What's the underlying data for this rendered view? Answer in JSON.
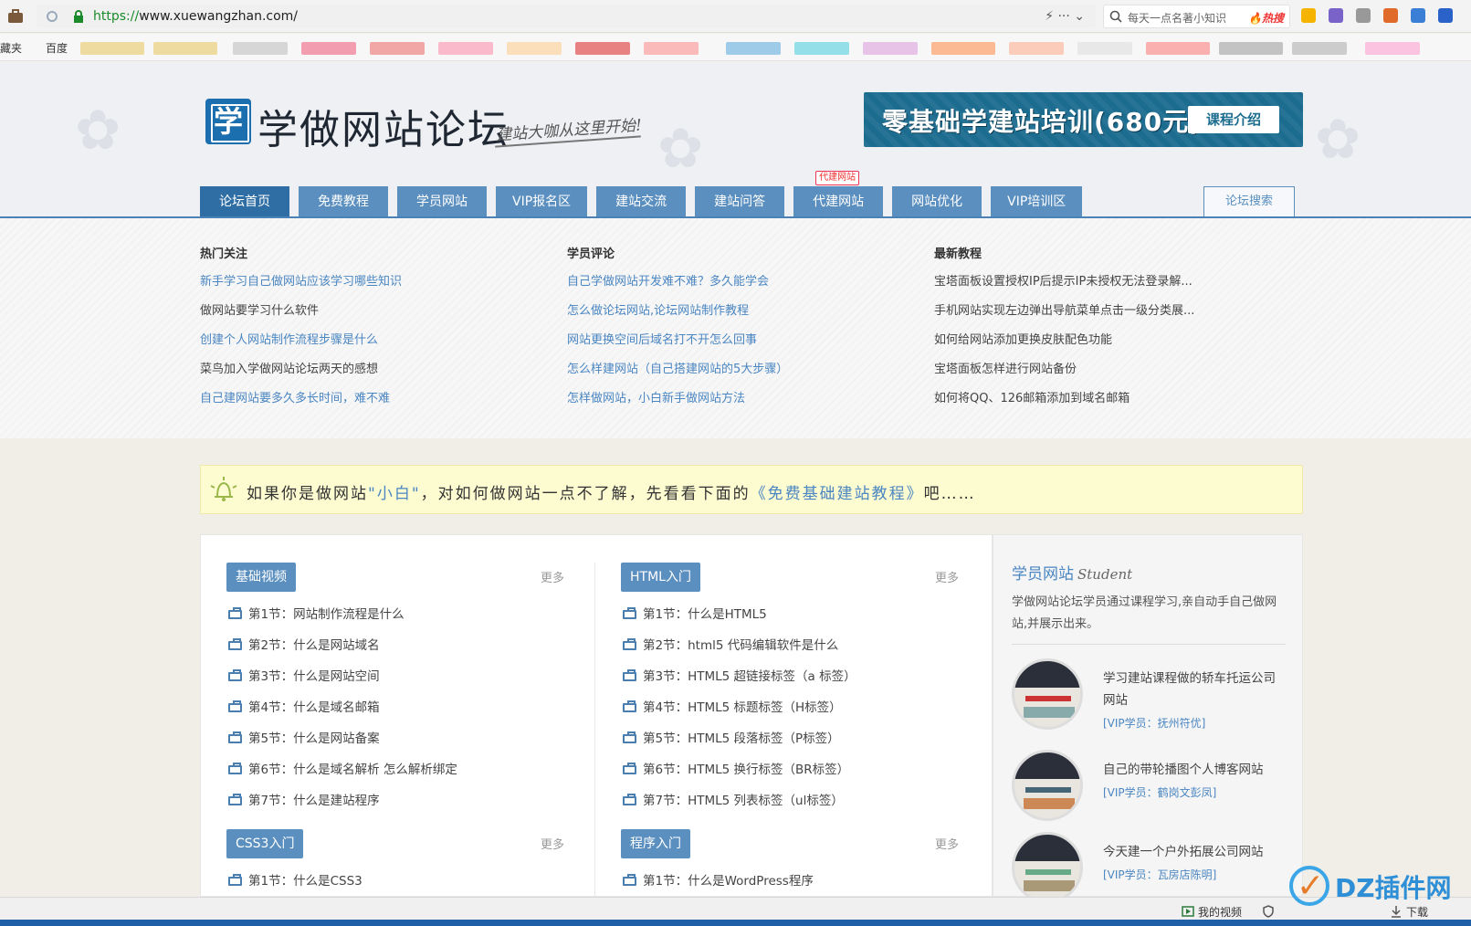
{
  "browser": {
    "url_scheme": "https://",
    "url_rest": "www.xuewangzhan.com/",
    "tools": "⚡  ···  ⌄",
    "search_hint": "每天一点名著小知识",
    "search_hot": "🔥热搜"
  },
  "bookmarks": {
    "favorites": "藏夹",
    "baidu": "百度"
  },
  "header": {
    "logo_glyph": "学",
    "site_title": "学做网站论坛",
    "slogan": "建站大咖从这里开始!",
    "banner_text": "零基础学建站培训(680元)",
    "banner_button": "课程介绍"
  },
  "nav": {
    "items": [
      {
        "label": "论坛首页"
      },
      {
        "label": "免费教程"
      },
      {
        "label": "学员网站"
      },
      {
        "label": "VIP报名区"
      },
      {
        "label": "建站交流"
      },
      {
        "label": "建站问答"
      },
      {
        "label": "代建网站",
        "badge": "代建网站"
      },
      {
        "label": "网站优化"
      },
      {
        "label": "VIP培训区"
      }
    ],
    "search_label": "论坛搜索"
  },
  "hot": {
    "columns": [
      {
        "heading": "热门关注",
        "links": [
          "新手学习自己做网站应该学习哪些知识",
          "做网站要学习什么软件",
          "创建个人网站制作流程步骤是什么",
          "菜鸟加入学做网站论坛两天的感想",
          "自己建网站要多久多长时间，难不难"
        ]
      },
      {
        "heading": "学员评论",
        "links": [
          "自己学做网站开发难不难？多久能学会",
          "怎么做论坛网站,论坛网站制作教程",
          "网站更换空间后域名打不开怎么回事",
          "怎么样建网站（自己搭建网站的5大步骤）",
          "怎样做网站，小白新手做网站方法"
        ]
      },
      {
        "heading": "最新教程",
        "links": [
          "宝塔面板设置授权IP后提示IP未授权无法登录解...",
          "手机网站实现左边弹出导航菜单点击一级分类展...",
          "如何给网站添加更换皮肤配色功能",
          "宝塔面板怎样进行网站备份",
          "如何将QQ、126邮箱添加到域名邮箱"
        ]
      }
    ]
  },
  "notice": {
    "part1": "如果你是做网站",
    "highlight": "\"小白\"",
    "part2": "，对如何做网站一点不了解，先看看下面的",
    "link": "《免费基础建站教程》",
    "part3": "吧……"
  },
  "blocks": [
    {
      "tag": "基础视频",
      "more": "更多",
      "lessons": [
        "第1节：网站制作流程是什么",
        "第2节：什么是网站域名",
        "第3节：什么是网站空间",
        "第4节：什么是域名邮箱",
        "第5节：什么是网站备案",
        "第6节：什么是域名解析 怎么解析绑定",
        "第7节：什么是建站程序"
      ]
    },
    {
      "tag": "HTML入门",
      "more": "更多",
      "lessons": [
        "第1节：什么是HTML5",
        "第2节：html5 代码编辑软件是什么",
        "第3节：HTML5 超链接标签（a 标签）",
        "第4节：HTML5 标题标签（H标签）",
        "第5节：HTML5 段落标签（P标签）",
        "第6节：HTML5 换行标签（BR标签）",
        "第7节：HTML5 列表标签（ul标签）"
      ]
    },
    {
      "tag": "CSS3入门",
      "more": "更多",
      "lessons": [
        "第1节：什么是CSS3"
      ]
    },
    {
      "tag": "程序入门",
      "more": "更多",
      "lessons": [
        "第1节：什么是WordPress程序"
      ]
    }
  ],
  "sidebar": {
    "title": "学员网站",
    "title_en": "Student",
    "desc": "学做网站论坛学员通过课程学习,亲自动手自己做网站,并展示出来。",
    "students": [
      {
        "name": "学习建站课程做的轿车托运公司网站",
        "meta": "[VIP学员：抚州符优]"
      },
      {
        "name": "自己的带轮播图个人博客网站",
        "meta": "[VIP学员：鹤岗文彭凤]"
      },
      {
        "name": "今天建一个户外拓展公司网站",
        "meta": "[VIP学员：瓦房店陈明]"
      }
    ]
  },
  "statusbar": {
    "video": "我的视频",
    "download": "下载"
  },
  "watermark": {
    "text": "DZ插件网"
  },
  "colors": {
    "nav": "#5a8fbf",
    "nav_active": "#2e6ea5",
    "link": "#4a86c2",
    "notice_bg": "#fdfbd0"
  }
}
